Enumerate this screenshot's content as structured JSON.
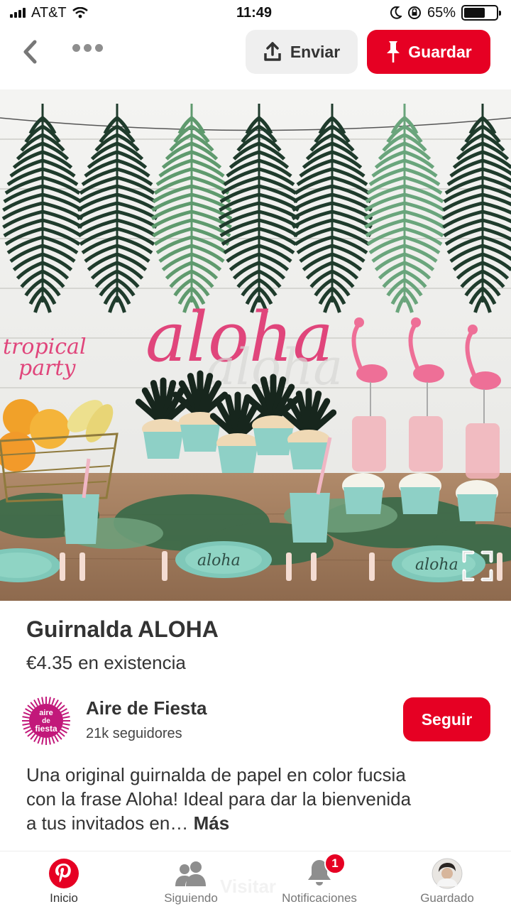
{
  "status_bar": {
    "carrier": "AT&T",
    "time": "11:49",
    "battery_percent": "65%",
    "battery_level": 0.65,
    "icons": [
      "signal-icon",
      "wifi-icon",
      "moon-icon",
      "rotation-lock-icon",
      "battery-icon"
    ]
  },
  "nav": {
    "send_label": "Enviar",
    "save_label": "Guardar",
    "icons": [
      "back-icon",
      "more-icon",
      "share-icon",
      "pin-icon"
    ]
  },
  "pin": {
    "image_text": "aloha",
    "topper_text_1": "tropical",
    "topper_text_2": "party",
    "title": "Guirnalda ALOHA",
    "price": "€4.35",
    "availability": "en existencia",
    "description": "Una original guirnalda de papel en color fucsia con la frase Aloha! Ideal para dar la bienvenida a tus invitados en…",
    "more_label": "Más"
  },
  "creator": {
    "logo_line1": "aire",
    "logo_line2": "de",
    "logo_line3": "fiesta",
    "name": "Aire de Fiesta",
    "followers": "21k seguidores",
    "follow_label": "Seguir"
  },
  "tab_bar": {
    "visit_ghost": "Visitar",
    "tabs": [
      {
        "label": "Inicio",
        "icon": "pinterest-icon"
      },
      {
        "label": "Siguiendo",
        "icon": "people-icon"
      },
      {
        "label": "Notificaciones",
        "icon": "bell-icon"
      },
      {
        "label": "Guardado",
        "icon": "profile-avatar"
      }
    ],
    "notification_count": "1"
  },
  "colors": {
    "brand_red": "#e60023",
    "creator_magenta": "#c2187a",
    "aloha_pink": "#e0457b"
  }
}
